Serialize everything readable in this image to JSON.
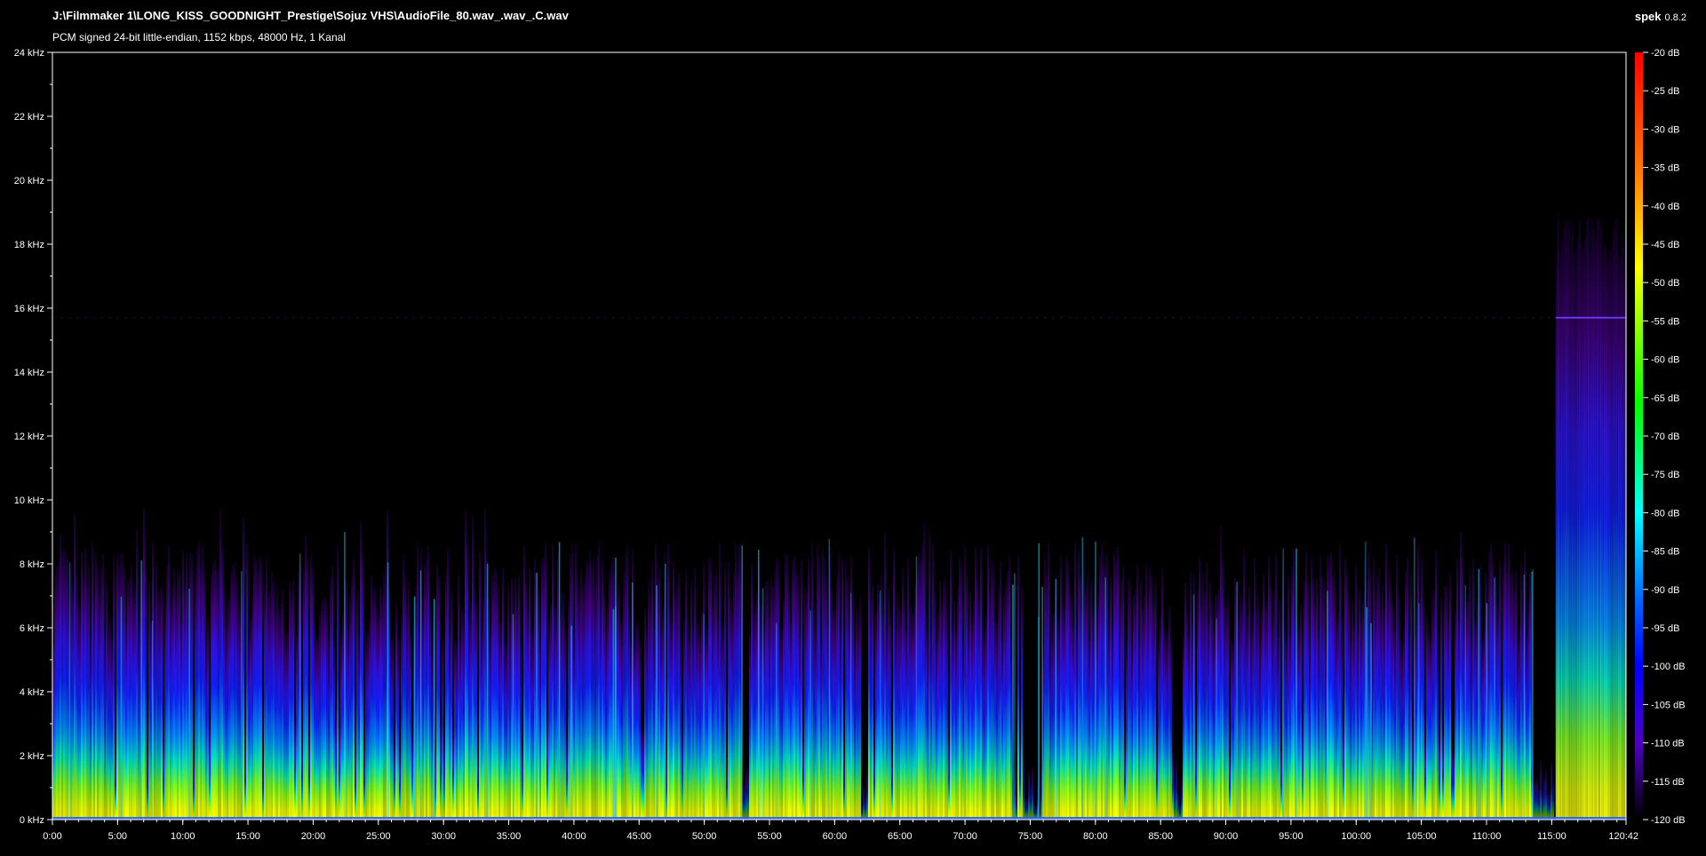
{
  "header": {
    "file_path": "J:\\Filmmaker 1\\LONG_KISS_GOODNIGHT_Prestige\\Sojuz VHS\\AudioFile_80.wav_.wav_.C.wav",
    "stream_info": "PCM signed 24-bit little-endian, 1152 kbps, 48000 Hz, 1 Kanal"
  },
  "brand": {
    "name": "spek",
    "version": "0.8.2"
  },
  "colors": {
    "background": "#000000",
    "axis": "#ffffff"
  },
  "freq_axis": {
    "labels": [
      "0 kHz",
      "2 kHz",
      "4 kHz",
      "6 kHz",
      "8 kHz",
      "10 kHz",
      "12 kHz",
      "14 kHz",
      "16 kHz",
      "18 kHz",
      "20 kHz",
      "22 kHz",
      "24 kHz"
    ],
    "max_khz": 24
  },
  "time_axis": {
    "labels": [
      "0:00",
      "5:00",
      "10:00",
      "15:00",
      "20:00",
      "25:00",
      "30:00",
      "35:00",
      "40:00",
      "45:00",
      "50:00",
      "55:00",
      "60:00",
      "65:00",
      "70:00",
      "75:00",
      "80:00",
      "85:00",
      "90:00",
      "95:00",
      "100:00",
      "105:00",
      "110:00",
      "115:00",
      "120:42"
    ],
    "duration_minutes": 120.7
  },
  "db_scale": {
    "labels": [
      "-20 dB",
      "-25 dB",
      "-30 dB",
      "-35 dB",
      "-40 dB",
      "-45 dB",
      "-50 dB",
      "-55 dB",
      "-60 dB",
      "-65 dB",
      "-70 dB",
      "-75 dB",
      "-80 dB",
      "-85 dB",
      "-90 dB",
      "-95 dB",
      "-100 dB",
      "-105 dB",
      "-110 dB",
      "-115 dB",
      "-120 dB"
    ],
    "gradient": [
      "#ff0000",
      "#ff8000",
      "#ffff00",
      "#00ff00",
      "#00ffff",
      "#0060ff",
      "#0000ff",
      "#5000c0",
      "#000000"
    ]
  }
}
